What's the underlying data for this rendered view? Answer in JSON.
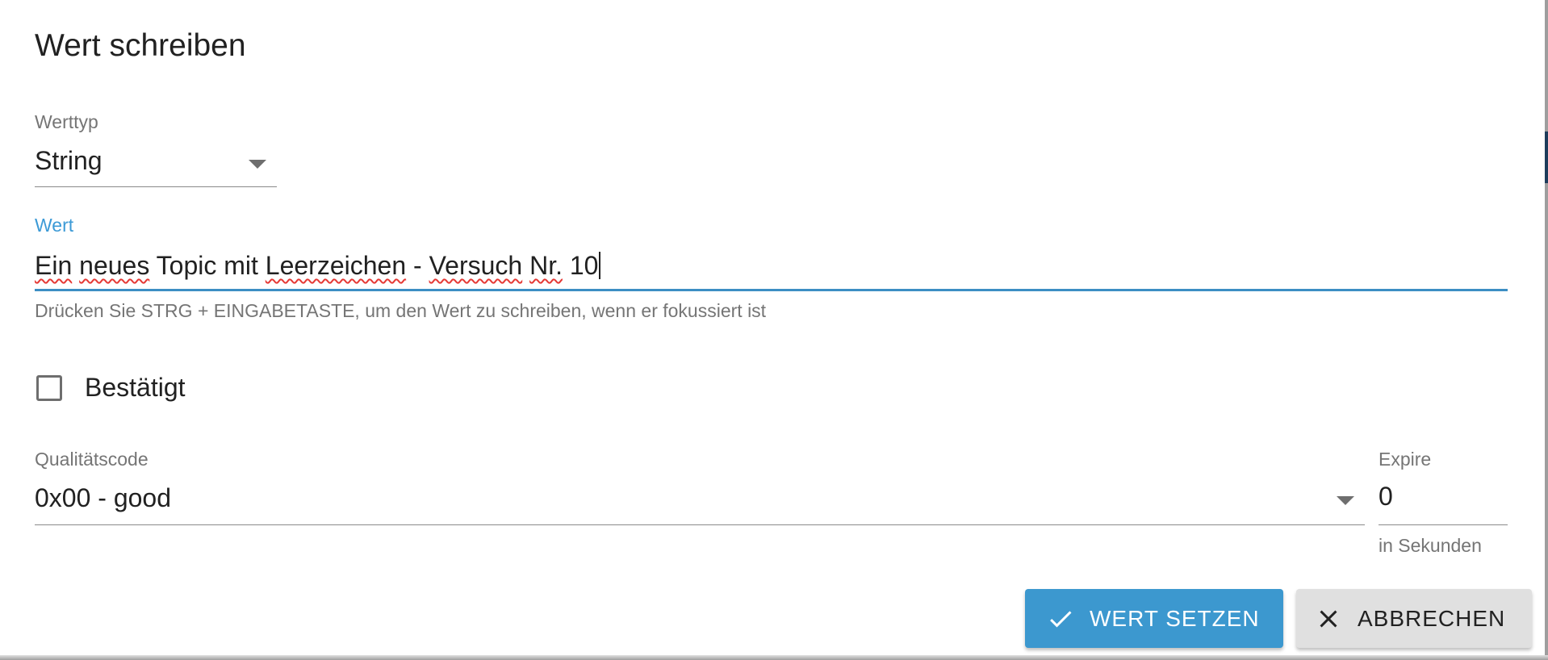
{
  "dialog": {
    "title": "Wert schreiben"
  },
  "werttyp": {
    "label": "Werttyp",
    "selected": "String"
  },
  "wert": {
    "label": "Wert",
    "value_words": [
      "Ein",
      "neues",
      "Topic",
      "mit",
      "Leerzeichen",
      "-",
      "Versuch",
      "Nr.",
      "10"
    ],
    "helper": "Drücken Sie STRG + EINGABETASTE, um den Wert zu schreiben, wenn er fokussiert ist"
  },
  "bestaetigt": {
    "label": "Bestätigt",
    "checked": false
  },
  "qualitaetscode": {
    "label": "Qualitätscode",
    "selected": "0x00 - good"
  },
  "expire": {
    "label": "Expire",
    "value": "0",
    "helper": "in Sekunden"
  },
  "actions": {
    "submit_label": "WERT SETZEN",
    "submit_icon": "check-icon",
    "cancel_label": "ABBRECHEN",
    "cancel_icon": "close-icon"
  },
  "colors": {
    "accent": "#3c98cf",
    "focus_label": "#3c9ad6",
    "secondary_button": "#e0e0e0",
    "spellcheck": "#e53935"
  }
}
